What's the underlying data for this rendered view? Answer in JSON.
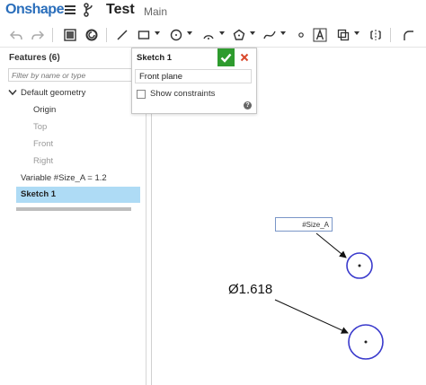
{
  "app": {
    "logo": "Onshape",
    "document_title": "Test",
    "workspace": "Main"
  },
  "toolbar": {
    "icons": [
      "undo-icon",
      "redo-icon",
      "sketch-tool-icon",
      "use-icon",
      "line-icon",
      "rectangle-icon",
      "circle-icon",
      "arc-icon",
      "polygon-icon",
      "spline-icon",
      "point-icon",
      "text-icon",
      "mirror-icon",
      "offset-icon",
      "fillet-icon"
    ]
  },
  "features": {
    "header": "Features (6)",
    "filter_placeholder": "Filter by name or type",
    "default_geometry": "Default geometry",
    "items": [
      "Origin",
      "Top",
      "Front",
      "Right"
    ],
    "variable": "Variable #Size_A = 1.2",
    "sketch": "Sketch 1"
  },
  "sketch_dialog": {
    "title": "Sketch 1",
    "plane": "Front plane",
    "show_constraints": "Show constraints",
    "help": "?"
  },
  "canvas": {
    "dimension_input": "#Size_A",
    "dimension_label": "Ø1.618"
  },
  "colors": {
    "accent_blue": "#2a6ebb",
    "selected_row": "#aedbf5",
    "ok_green": "#2e9b2e",
    "cancel_red": "#d9492c",
    "circle_stroke": "#3a3acc"
  }
}
